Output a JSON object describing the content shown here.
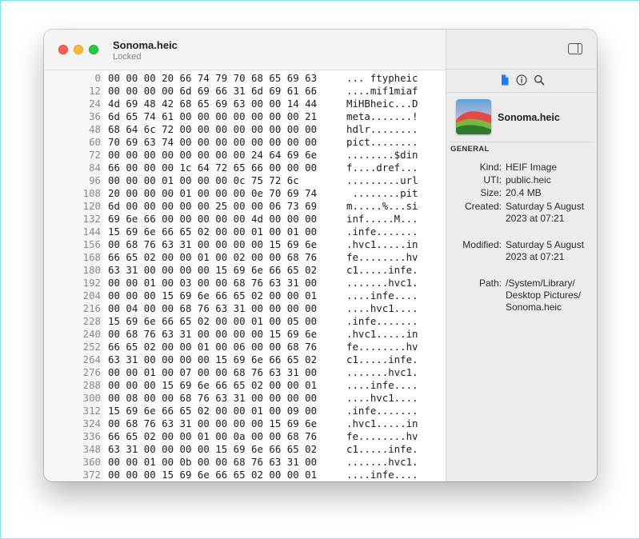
{
  "window": {
    "title": "Sonoma.heic",
    "subtitle": "Locked"
  },
  "hex": {
    "rows": [
      {
        "offset": "0",
        "bytes": "00 00 00 20 66 74 79 70 68 65 69 63",
        "ascii": "... ftypheic"
      },
      {
        "offset": "12",
        "bytes": "00 00 00 00 6d 69 66 31 6d 69 61 66",
        "ascii": "....mif1miaf"
      },
      {
        "offset": "24",
        "bytes": "4d 69 48 42 68 65 69 63 00 00 14 44",
        "ascii": "MiHBheic...D"
      },
      {
        "offset": "36",
        "bytes": "6d 65 74 61 00 00 00 00 00 00 00 21",
        "ascii": "meta.......!"
      },
      {
        "offset": "48",
        "bytes": "68 64 6c 72 00 00 00 00 00 00 00 00",
        "ascii": "hdlr........"
      },
      {
        "offset": "60",
        "bytes": "70 69 63 74 00 00 00 00 00 00 00 00",
        "ascii": "pict........"
      },
      {
        "offset": "72",
        "bytes": "00 00 00 00 00 00 00 00 24 64 69 6e",
        "ascii": "........$din"
      },
      {
        "offset": "84",
        "bytes": "66 00 00 00 1c 64 72 65 66 00 00 00",
        "ascii": "f....dref..."
      },
      {
        "offset": "96",
        "bytes": "00 00 00 01 00 00 00 0c 75 72 6c",
        "ascii": ".........url"
      },
      {
        "offset": "108",
        "bytes": "20 00 00 00 01 00 00 00 0e 70 69 74",
        "ascii": " ........pit"
      },
      {
        "offset": "120",
        "bytes": "6d 00 00 00 00 00 25 00 00 06 73 69",
        "ascii": "m.....%...si"
      },
      {
        "offset": "132",
        "bytes": "69 6e 66 00 00 00 00 00 4d 00 00 00",
        "ascii": "inf.....M..."
      },
      {
        "offset": "144",
        "bytes": "15 69 6e 66 65 02 00 00 01 00 01 00",
        "ascii": ".infe......."
      },
      {
        "offset": "156",
        "bytes": "00 68 76 63 31 00 00 00 00 15 69 6e",
        "ascii": ".hvc1.....in"
      },
      {
        "offset": "168",
        "bytes": "66 65 02 00 00 01 00 02 00 00 68 76",
        "ascii": "fe........hv"
      },
      {
        "offset": "180",
        "bytes": "63 31 00 00 00 00 15 69 6e 66 65 02",
        "ascii": "c1.....infe."
      },
      {
        "offset": "192",
        "bytes": "00 00 01 00 03 00 00 68 76 63 31 00",
        "ascii": ".......hvc1."
      },
      {
        "offset": "204",
        "bytes": "00 00 00 15 69 6e 66 65 02 00 00 01",
        "ascii": "....infe...."
      },
      {
        "offset": "216",
        "bytes": "00 04 00 00 68 76 63 31 00 00 00 00",
        "ascii": "....hvc1...."
      },
      {
        "offset": "228",
        "bytes": "15 69 6e 66 65 02 00 00 01 00 05 00",
        "ascii": ".infe......."
      },
      {
        "offset": "240",
        "bytes": "00 68 76 63 31 00 00 00 00 15 69 6e",
        "ascii": ".hvc1.....in"
      },
      {
        "offset": "252",
        "bytes": "66 65 02 00 00 01 00 06 00 00 68 76",
        "ascii": "fe........hv"
      },
      {
        "offset": "264",
        "bytes": "63 31 00 00 00 00 15 69 6e 66 65 02",
        "ascii": "c1.....infe."
      },
      {
        "offset": "276",
        "bytes": "00 00 01 00 07 00 00 68 76 63 31 00",
        "ascii": ".......hvc1."
      },
      {
        "offset": "288",
        "bytes": "00 00 00 15 69 6e 66 65 02 00 00 01",
        "ascii": "....infe...."
      },
      {
        "offset": "300",
        "bytes": "00 08 00 00 68 76 63 31 00 00 00 00",
        "ascii": "....hvc1...."
      },
      {
        "offset": "312",
        "bytes": "15 69 6e 66 65 02 00 00 01 00 09 00",
        "ascii": ".infe......."
      },
      {
        "offset": "324",
        "bytes": "00 68 76 63 31 00 00 00 00 15 69 6e",
        "ascii": ".hvc1.....in"
      },
      {
        "offset": "336",
        "bytes": "66 65 02 00 00 01 00 0a 00 00 68 76",
        "ascii": "fe........hv"
      },
      {
        "offset": "348",
        "bytes": "63 31 00 00 00 00 15 69 6e 66 65 02",
        "ascii": "c1.....infe."
      },
      {
        "offset": "360",
        "bytes": "00 00 01 00 0b 00 00 68 76 63 31 00",
        "ascii": ".......hvc1."
      },
      {
        "offset": "372",
        "bytes": "00 00 00 15 69 6e 66 65 02 00 00 01",
        "ascii": "....infe...."
      }
    ]
  },
  "inspector": {
    "tabs": [
      {
        "icon": "document-icon",
        "active": true
      },
      {
        "icon": "info-icon",
        "active": false
      },
      {
        "icon": "search-icon",
        "active": false
      }
    ],
    "filename": "Sonoma.heic",
    "section": "GENERAL",
    "fields": [
      {
        "key": "Kind:",
        "value": "HEIF Image"
      },
      {
        "key": "UTI:",
        "value": "public.heic"
      },
      {
        "key": "Size:",
        "value": "20.4 MB"
      },
      {
        "key": "Created:",
        "value": "Saturday 5 August 2023 at 07:21"
      },
      {
        "key": "Modified:",
        "value": "Saturday 5 August 2023 at 07:21"
      },
      {
        "key": "Path:",
        "value": "/System/Library/ Desktop Pictures/ Sonoma.heic"
      }
    ],
    "accent": "#1e7cf2"
  }
}
